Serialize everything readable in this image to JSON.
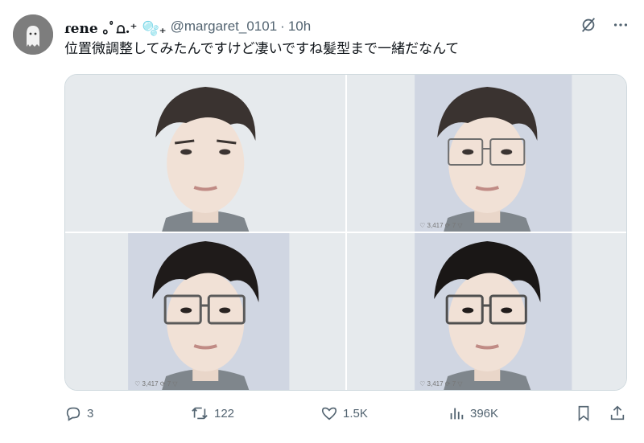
{
  "tweet": {
    "display_name": "ɾene ｡ﾟ⩍.⁺ 🫧₊",
    "handle": "@margaret_0101",
    "separator": "·",
    "time": "10h",
    "text": "位置微調整してみたんですけど凄いですね髪型まで一緒だなんて"
  },
  "media": {
    "photos": [
      {
        "description_icon": "portrait-photo",
        "has_glasses": false,
        "level_hint": "original"
      },
      {
        "description_icon": "portrait-photo",
        "has_glasses": true,
        "level_hint": "faint"
      },
      {
        "description_icon": "portrait-photo",
        "has_glasses": true,
        "level_hint": "medium"
      },
      {
        "description_icon": "portrait-photo",
        "has_glasses": true,
        "level_hint": "strong"
      }
    ],
    "overlay_texts": {
      "likes_small": "3,417",
      "reply_small": "7"
    }
  },
  "actions": {
    "replies": "3",
    "retweets": "122",
    "likes": "1.5K",
    "views": "396K"
  },
  "colors": {
    "text": "#0f1419",
    "muted": "#536471",
    "border": "#cfd9de"
  }
}
